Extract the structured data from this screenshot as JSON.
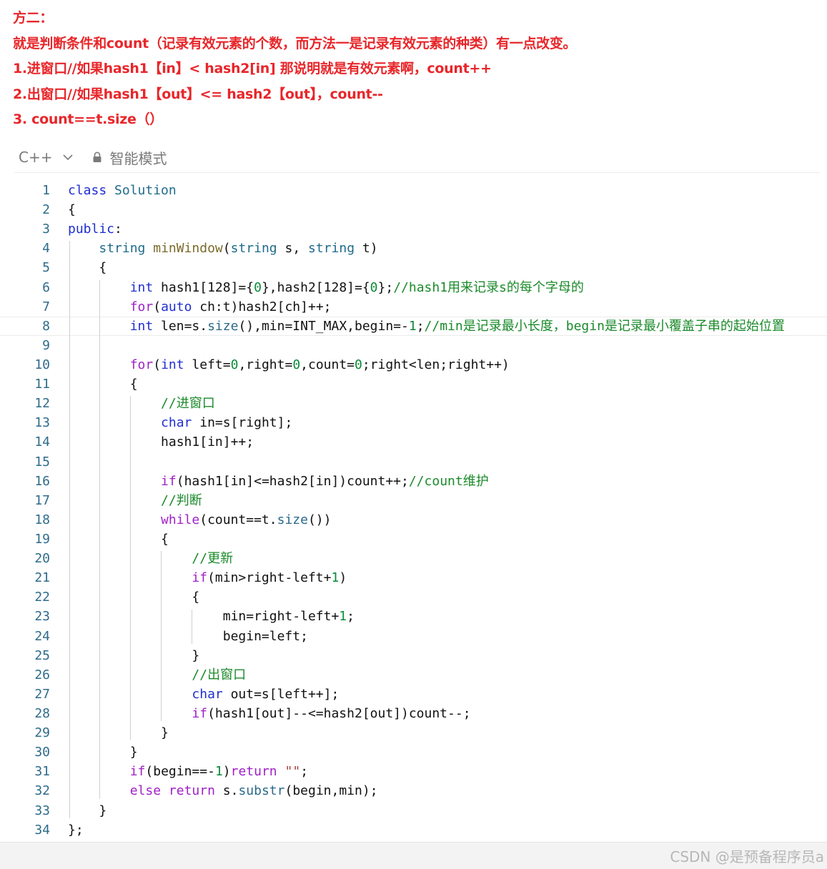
{
  "notes": [
    "方二：",
    "就是判断条件和count（记录有效元素的个数，而方法一是记录有效元素的种类）有一点改变。",
    "1.进窗口//如果hash1【in】< hash2[in] 那说明就是有效元素啊，count++",
    "2.出窗口//如果hash1【out】<= hash2【out】，count--",
    "3. count==t.size（）"
  ],
  "toolbar": {
    "language": "C++",
    "mode": "智能模式"
  },
  "code": {
    "line_numbers": [
      "1",
      "2",
      "3",
      "4",
      "5",
      "6",
      "7",
      "8",
      "9",
      "10",
      "11",
      "12",
      "13",
      "14",
      "15",
      "16",
      "17",
      "18",
      "19",
      "20",
      "21",
      "22",
      "23",
      "24",
      "25",
      "26",
      "27",
      "28",
      "29",
      "30",
      "31",
      "32",
      "33",
      "34"
    ],
    "active_line": 8,
    "lines": [
      [
        [
          "kw",
          "class"
        ],
        [
          "p",
          " "
        ],
        [
          "typ",
          "Solution"
        ]
      ],
      [
        [
          "p",
          "{"
        ]
      ],
      [
        [
          "kw",
          "public"
        ],
        [
          "p",
          ":"
        ]
      ],
      [
        [
          "p",
          "    "
        ],
        [
          "typ",
          "string"
        ],
        [
          "p",
          " "
        ],
        [
          "fn",
          "minWindow"
        ],
        [
          "p",
          "("
        ],
        [
          "typ",
          "string"
        ],
        [
          "p",
          " s, "
        ],
        [
          "typ",
          "string"
        ],
        [
          "p",
          " t)"
        ]
      ],
      [
        [
          "p",
          "    {"
        ]
      ],
      [
        [
          "p",
          "        "
        ],
        [
          "kw",
          "int"
        ],
        [
          "p",
          " hash1[128]={"
        ],
        [
          "num",
          "0"
        ],
        [
          "p",
          "},hash2[128]={"
        ],
        [
          "num",
          "0"
        ],
        [
          "p",
          "};"
        ],
        [
          "cm",
          "//hash1用来记录s的每个字母的"
        ]
      ],
      [
        [
          "p",
          "        "
        ],
        [
          "ctl",
          "for"
        ],
        [
          "p",
          "("
        ],
        [
          "kw",
          "auto"
        ],
        [
          "p",
          " ch:t)hash2[ch]++;"
        ]
      ],
      [
        [
          "p",
          "        "
        ],
        [
          "kw",
          "int"
        ],
        [
          "p",
          " len=s."
        ],
        [
          "call",
          "size"
        ],
        [
          "p",
          "(),min=INT_MAX,begin=-"
        ],
        [
          "num",
          "1"
        ],
        [
          "p",
          ";"
        ],
        [
          "cm",
          "//min是记录最小长度，begin是记录最小覆盖子串的起始位置"
        ]
      ],
      [
        [
          "p",
          ""
        ]
      ],
      [
        [
          "p",
          "        "
        ],
        [
          "ctl",
          "for"
        ],
        [
          "p",
          "("
        ],
        [
          "kw",
          "int"
        ],
        [
          "p",
          " left="
        ],
        [
          "num",
          "0"
        ],
        [
          "p",
          ",right="
        ],
        [
          "num",
          "0"
        ],
        [
          "p",
          ",count="
        ],
        [
          "num",
          "0"
        ],
        [
          "p",
          ";right<len;right++)"
        ]
      ],
      [
        [
          "p",
          "        {"
        ]
      ],
      [
        [
          "p",
          "            "
        ],
        [
          "cm",
          "//进窗口"
        ]
      ],
      [
        [
          "p",
          "            "
        ],
        [
          "kw",
          "char"
        ],
        [
          "p",
          " in=s[right];"
        ]
      ],
      [
        [
          "p",
          "            hash1[in]++;"
        ]
      ],
      [
        [
          "p",
          ""
        ]
      ],
      [
        [
          "p",
          "            "
        ],
        [
          "ctl",
          "if"
        ],
        [
          "p",
          "(hash1[in]<=hash2[in])count++;"
        ],
        [
          "cm",
          "//count维护"
        ]
      ],
      [
        [
          "p",
          "            "
        ],
        [
          "cm",
          "//判断"
        ]
      ],
      [
        [
          "p",
          "            "
        ],
        [
          "ctl",
          "while"
        ],
        [
          "p",
          "(count==t."
        ],
        [
          "call",
          "size"
        ],
        [
          "p",
          "())"
        ]
      ],
      [
        [
          "p",
          "            {"
        ]
      ],
      [
        [
          "p",
          "                "
        ],
        [
          "cm",
          "//更新"
        ]
      ],
      [
        [
          "p",
          "                "
        ],
        [
          "ctl",
          "if"
        ],
        [
          "p",
          "(min>right-left+"
        ],
        [
          "num",
          "1"
        ],
        [
          "p",
          ")"
        ]
      ],
      [
        [
          "p",
          "                {"
        ]
      ],
      [
        [
          "p",
          "                    min=right-left+"
        ],
        [
          "num",
          "1"
        ],
        [
          "p",
          ";"
        ]
      ],
      [
        [
          "p",
          "                    begin=left;"
        ]
      ],
      [
        [
          "p",
          "                }"
        ]
      ],
      [
        [
          "p",
          "                "
        ],
        [
          "cm",
          "//出窗口"
        ]
      ],
      [
        [
          "p",
          "                "
        ],
        [
          "kw",
          "char"
        ],
        [
          "p",
          " out=s[left++];"
        ]
      ],
      [
        [
          "p",
          "                "
        ],
        [
          "ctl",
          "if"
        ],
        [
          "p",
          "(hash1[out]--<=hash2[out])count--;"
        ]
      ],
      [
        [
          "p",
          "            }"
        ]
      ],
      [
        [
          "p",
          "        }"
        ]
      ],
      [
        [
          "p",
          "        "
        ],
        [
          "ctl",
          "if"
        ],
        [
          "p",
          "(begin==-"
        ],
        [
          "num",
          "1"
        ],
        [
          "p",
          ")"
        ],
        [
          "ctl",
          "return"
        ],
        [
          "p",
          " "
        ],
        [
          "str",
          "\"\""
        ],
        [
          "p",
          ";"
        ]
      ],
      [
        [
          "p",
          "        "
        ],
        [
          "ctl",
          "else"
        ],
        [
          "p",
          " "
        ],
        [
          "ctl",
          "return"
        ],
        [
          "p",
          " s."
        ],
        [
          "call",
          "substr"
        ],
        [
          "p",
          "(begin,min);"
        ]
      ],
      [
        [
          "p",
          "    }"
        ]
      ],
      [
        [
          "p",
          "};"
        ]
      ]
    ]
  },
  "footer": {
    "watermark": "CSDN @是预备程序员a"
  },
  "colors": {
    "note_red": "#e8262a",
    "keyword": "#1f2ed0",
    "control": "#a020c8",
    "comment": "#1a8a2a",
    "number": "#0a8a3a",
    "line_number": "#2e6b8a"
  }
}
